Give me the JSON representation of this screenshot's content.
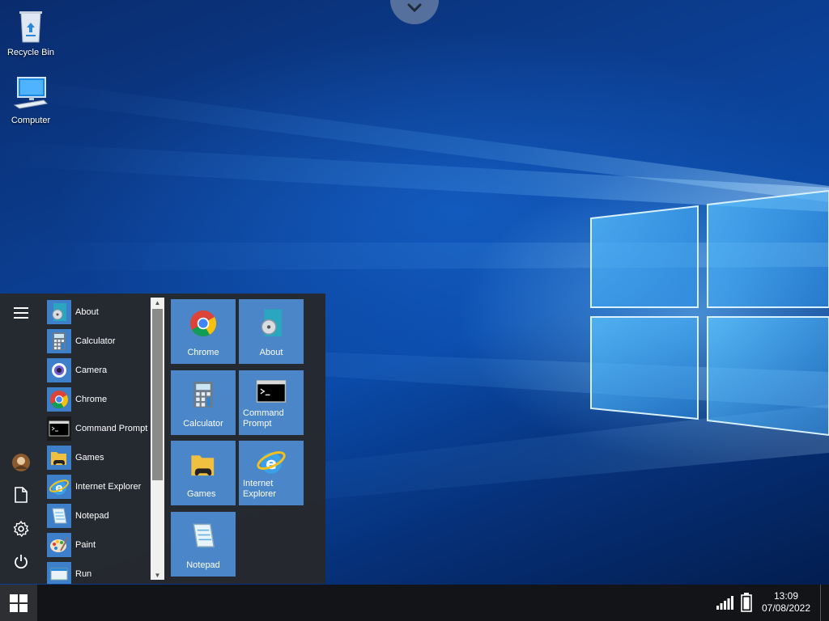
{
  "desktop": {
    "icons": [
      {
        "label": "Recycle Bin",
        "icon": "recycle-bin-icon"
      },
      {
        "label": "Computer",
        "icon": "computer-icon"
      }
    ]
  },
  "start_menu": {
    "rail": {
      "menu_icon": "hamburger-icon",
      "user_icon": "avatar",
      "documents_icon": "document-icon",
      "settings_icon": "gear-icon",
      "power_icon": "power-icon"
    },
    "apps": [
      {
        "label": "About",
        "icon": "about-icon"
      },
      {
        "label": "Calculator",
        "icon": "calculator-icon"
      },
      {
        "label": "Camera",
        "icon": "camera-icon"
      },
      {
        "label": "Chrome",
        "icon": "chrome-icon"
      },
      {
        "label": "Command Prompt",
        "icon": "command-prompt-icon"
      },
      {
        "label": "Games",
        "icon": "games-icon"
      },
      {
        "label": "Internet Explorer",
        "icon": "internet-explorer-icon"
      },
      {
        "label": "Notepad",
        "icon": "notepad-icon"
      },
      {
        "label": "Paint",
        "icon": "paint-icon"
      },
      {
        "label": "Run",
        "icon": "run-icon"
      }
    ],
    "tiles": [
      {
        "label": "Chrome",
        "icon": "chrome-icon"
      },
      {
        "label": "About",
        "icon": "about-icon"
      },
      {
        "label": "Calculator",
        "icon": "calculator-icon"
      },
      {
        "label_line1": "Command",
        "label_line2": "Prompt",
        "icon": "command-prompt-icon"
      },
      {
        "label": "Games",
        "icon": "games-icon"
      },
      {
        "label_line1": "Internet",
        "label_line2": "Explorer",
        "icon": "internet-explorer-icon"
      },
      {
        "label": "Notepad",
        "icon": "notepad-icon"
      }
    ]
  },
  "taskbar": {
    "start_icon": "windows-logo-icon",
    "signal_icon": "signal-icon",
    "battery_icon": "battery-icon",
    "time": "13:09",
    "date": "07/08/2022"
  },
  "colors": {
    "tile": "#4a86c8",
    "start_menu_bg": "#26282c",
    "taskbar_bg": "#121417"
  }
}
